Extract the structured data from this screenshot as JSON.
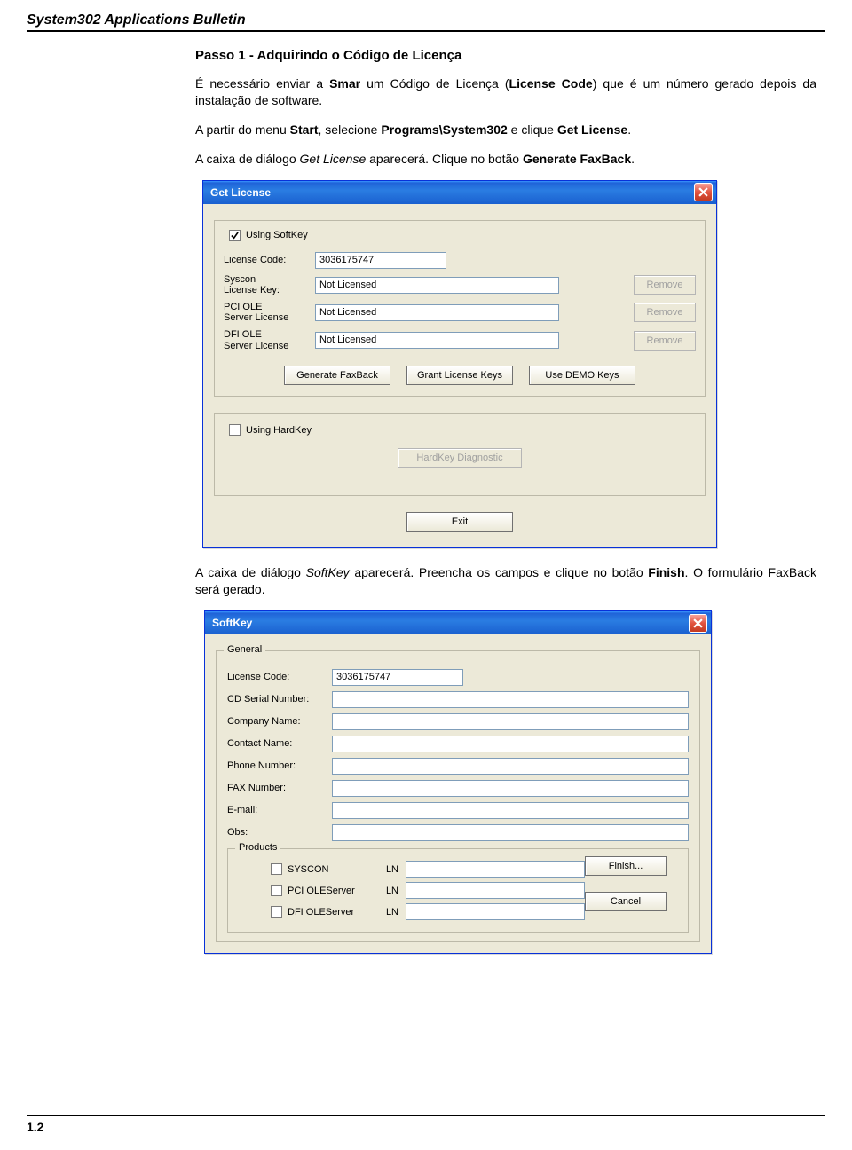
{
  "header": "System302 Applications Bulletin",
  "step_title": "Passo 1 - Adquirindo o Código de Licença",
  "para1_parts": {
    "p1": "É necessário enviar a ",
    "smar": "Smar",
    "p2": " um Código de Licença (",
    "lc": "License Code",
    "p3": ") que é um número  gerado depois da instalação de software."
  },
  "para2_parts": {
    "p1": "A partir do menu ",
    "start": "Start",
    "p2": ", selecione ",
    "prog": "Programs\\System302",
    "p3": " e clique ",
    "gl": "Get License",
    "p4": "."
  },
  "para3_parts": {
    "p1": "A caixa de diálogo ",
    "gl": "Get License",
    "p2": " aparecerá. Clique no botão ",
    "gfb": "Generate FaxBack",
    "p3": "."
  },
  "para4_parts": {
    "p1": "A caixa de diálogo ",
    "sk": "SoftKey",
    "p2": " aparecerá. Preencha os campos e clique no botão ",
    "fin": "Finish",
    "p3": ". O formulário FaxBack será gerado."
  },
  "dialog1": {
    "title": "Get License",
    "using_softkey": "Using SoftKey",
    "license_code_label": "License Code:",
    "license_code_value": "3036175747",
    "syscon_label": "Syscon\nLicense Key:",
    "syscon_value": "Not Licensed",
    "pci_label": "PCI OLE\nServer License",
    "pci_value": "Not Licensed",
    "dfi_label": "DFI OLE\nServer License",
    "dfi_value": "Not Licensed",
    "remove": "Remove",
    "gen_faxback": "Generate FaxBack",
    "grant_keys": "Grant License Keys",
    "demo_keys": "Use DEMO Keys",
    "using_hardkey": "Using HardKey",
    "hardkey_diag": "HardKey Diagnostic",
    "exit": "Exit"
  },
  "dialog2": {
    "title": "SoftKey",
    "group_general": "General",
    "license_code_label": "License Code:",
    "license_code_value": "3036175747",
    "cd_serial_label": "CD Serial Number:",
    "company_label": "Company Name:",
    "contact_label": "Contact Name:",
    "phone_label": "Phone Number:",
    "fax_label": "FAX Number:",
    "email_label": "E-mail:",
    "obs_label": "Obs:",
    "group_products": "Products",
    "prod_syscon": "SYSCON",
    "prod_pci": "PCI OLEServer",
    "prod_dfi": "DFI OLEServer",
    "ln": "LN",
    "finish": "Finish...",
    "cancel": "Cancel"
  },
  "page_num": "1.2"
}
